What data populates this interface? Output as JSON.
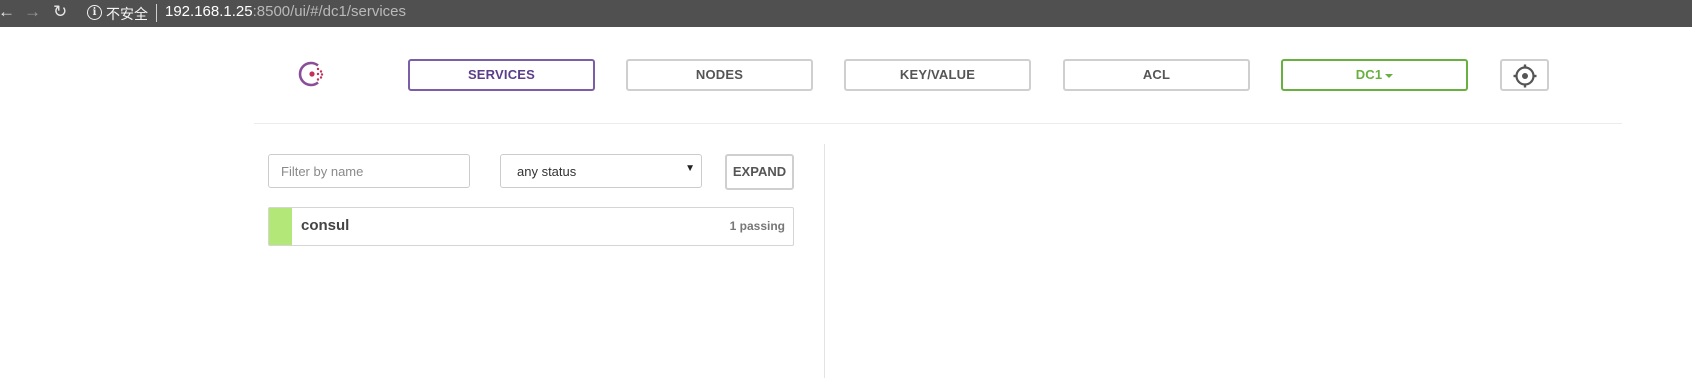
{
  "browser": {
    "back_icon": "arrow-left-icon",
    "forward_icon": "arrow-right-icon",
    "reload_icon": "reload-icon",
    "security_label": "不安全",
    "url_host": "192.168.1.25",
    "url_rest": ":8500/ui/#/dc1/services"
  },
  "nav": {
    "logo_icon": "consul-logo-icon",
    "items": [
      {
        "label": "SERVICES",
        "active": true
      },
      {
        "label": "NODES",
        "active": false
      },
      {
        "label": "KEY/VALUE",
        "active": false
      },
      {
        "label": "ACL",
        "active": false
      }
    ],
    "datacenter_label": "DC1",
    "settings_icon": "gear-icon"
  },
  "filters": {
    "name_placeholder": "Filter by name",
    "status_value": "any status",
    "expand_label": "EXPAND"
  },
  "services": [
    {
      "name": "consul",
      "checks": "1 passing",
      "status_color": "#b3e879"
    }
  ],
  "colors": {
    "active_nav": "#7b5ea7",
    "datacenter": "#68b03f",
    "passing": "#b3e879"
  }
}
